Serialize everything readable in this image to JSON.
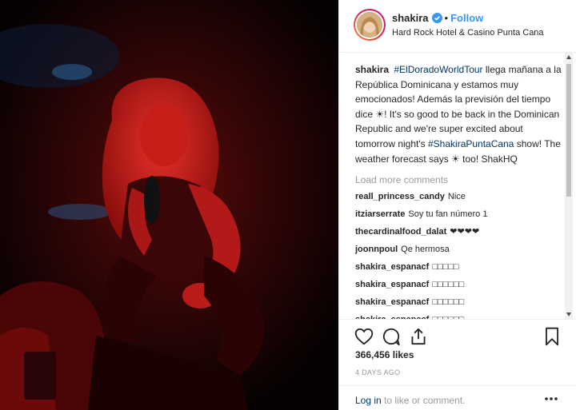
{
  "header": {
    "username": "shakira",
    "separator": "•",
    "follow_label": "Follow",
    "location": "Hard Rock Hotel & Casino Punta Cana"
  },
  "caption": {
    "username": "shakira",
    "hashtag1": "#ElDoradoWorldTour",
    "text1": " llega mañana a la República Dominicana y estamos muy emocionados! Además la previsión del tiempo dice ☀! It's so good to be back in the Dominican Republic and we're super excited about tomorrow night's ",
    "hashtag2": "#ShakiraPuntaCana",
    "text2": " show! The weather forecast says ☀ too! ShakHQ"
  },
  "load_more": "Load more comments",
  "comments": [
    {
      "username": "reall_princess_candy",
      "text": "Nice"
    },
    {
      "username": "itziarserrate",
      "text": "Soy tu fan número 1"
    },
    {
      "username": "thecardinalfood_dalat",
      "text": "❤❤❤❤"
    },
    {
      "username": "joonnpoul",
      "text": "Qe hermosa"
    },
    {
      "username": "shakira_espanacf",
      "text": "□□□□□"
    },
    {
      "username": "shakira_espanacf",
      "text": "□□□□□□"
    },
    {
      "username": "shakira_espanacf",
      "text": "□□□□□□"
    },
    {
      "username": "shakira_espanacf",
      "text": "□□□□□□"
    }
  ],
  "actions": {
    "like_icon": "heart-icon",
    "comment_icon": "comment-icon",
    "share_icon": "share-icon",
    "save_icon": "bookmark-icon"
  },
  "likes": "366,456 likes",
  "timestamp": "4 DAYS AGO",
  "footer": {
    "login_link": "Log in",
    "login_text": " to like or comment.",
    "more_icon": "more-options-icon"
  },
  "colors": {
    "link_blue": "#3897f0",
    "hashtag_blue": "#003569",
    "muted": "#999999",
    "photo_red": "#c0181a"
  }
}
